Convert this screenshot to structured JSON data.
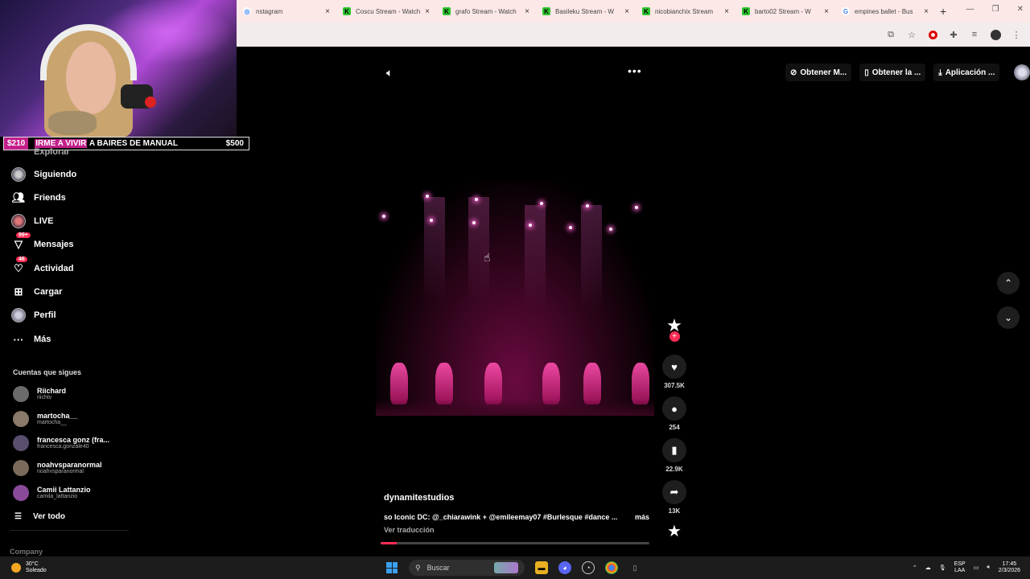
{
  "browser": {
    "tabs": [
      {
        "title": "nstagram",
        "icon": "instagram-icon"
      },
      {
        "title": "Coscu Stream - Watch",
        "icon": "kick-icon"
      },
      {
        "title": "grafo Stream - Watch",
        "icon": "kick-icon"
      },
      {
        "title": "Basileku Stream - W",
        "icon": "kick-icon"
      },
      {
        "title": "nicobianchix Stream",
        "icon": "kick-icon"
      },
      {
        "title": "barto02 Stream - W",
        "icon": "kick-icon"
      },
      {
        "title": "empines ballet - Bus",
        "icon": "google-icon"
      }
    ],
    "new_tab": "+",
    "close": "×"
  },
  "stream_overlay": {
    "donation_amount": "$210",
    "donation_highlight": "IRME A VIVIR",
    "donation_text": " A BAIRES DE MANUAL",
    "goal": "$500"
  },
  "sidebar": {
    "partial_item": "Explorar",
    "items": [
      {
        "label": "Siguiendo",
        "icon": "following-avatar-icon"
      },
      {
        "label": "Friends",
        "icon": "friends-icon"
      },
      {
        "label": "LIVE",
        "icon": "live-icon"
      },
      {
        "label": "Mensajes",
        "icon": "messages-icon",
        "badge": "99+"
      },
      {
        "label": "Actividad",
        "icon": "activity-icon",
        "badge": "46"
      },
      {
        "label": "Cargar",
        "icon": "upload-icon"
      },
      {
        "label": "Perfil",
        "icon": "profile-icon"
      },
      {
        "label": "Más",
        "icon": "more-icon"
      }
    ],
    "following_title": "Cuentas que sigues",
    "accounts": [
      {
        "name": "Riichard",
        "handle": "riichtv",
        "color": "#6b6b6b"
      },
      {
        "name": "martocha__",
        "handle": "martocha__",
        "color": "#8a7a6a"
      },
      {
        "name": "francesca gonz (fra...",
        "handle": "francesca.gonzale40",
        "color": "#5a4e6e"
      },
      {
        "name": "noahvsparanormal",
        "handle": "noahvsparanormal",
        "color": "#7a6a5a"
      },
      {
        "name": "Camii Lattanzio",
        "handle": "camila_lattanzio",
        "color": "#8a4a9a"
      }
    ],
    "see_all": "Ver todo",
    "company": "Company"
  },
  "top_actions": {
    "get_coins": "Obtener M...",
    "get_app": "Obtener la ...",
    "desktop_app": "Aplicación ..."
  },
  "video": {
    "author": "dynamitestudios",
    "caption": "so Iconic DC: @_chiarawink + @emileemay07 #Burlesque #dance ...",
    "more": "más",
    "translate": "Ver traducción",
    "progress": 0.06
  },
  "rail": {
    "likes": "307.5K",
    "comments": "254",
    "saves": "22.9K",
    "shares": "13K"
  },
  "taskbar": {
    "temperature": "30°C",
    "weather": "Soleado",
    "search_placeholder": "Buscar",
    "lang1": "ESP",
    "lang2": "LAA",
    "time": "17:45",
    "date": "2/3/2026"
  }
}
